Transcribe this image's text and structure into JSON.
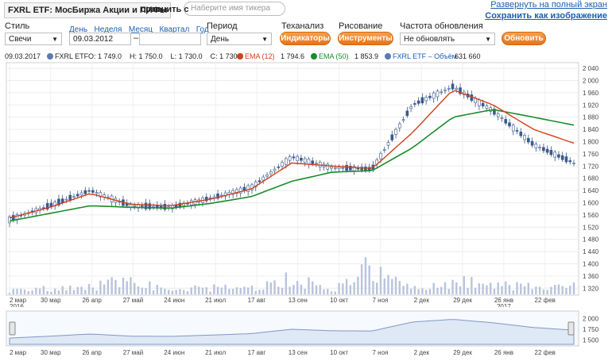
{
  "header": {
    "instrument": "FXRL ETF: МосБиржа Акции и ПИФы",
    "compare_label": "сравнить с",
    "ticker_placeholder": "Наберите имя тикера",
    "fullscreen_link": "Развернуть на полный экран",
    "save_image_link": "Сохранить как изображение"
  },
  "controls": {
    "style_label": "Стиль",
    "style_value": "Свечи",
    "period_links": [
      "День",
      "Неделя",
      "Месяц",
      "Квартал",
      "Год"
    ],
    "date_from": "09.03.2012",
    "date_dash": "–",
    "date_to": "",
    "period_label": "Период",
    "period_value": "День",
    "techanalysis_label": "Теханализ",
    "indicators_button": "Индикаторы",
    "drawing_label": "Рисование",
    "tools_button": "Инструменты",
    "refresh_label": "Частота обновления",
    "refresh_value": "Не обновлять",
    "update_button": "Обновить"
  },
  "legend": {
    "date": "09.03.2017",
    "series_name": "FXRL ETF",
    "ohlc": "O: 1 749.0    H: 1 750.0    L: 1 730.0    C: 1 730.0",
    "ema12_label": "EMA (12)",
    "ema12_value": "1 794.6",
    "ema50_label": "EMA (50)",
    "ema50_value": "1 853.9",
    "volume_label": "FXRL ETF – Объём",
    "volume_value": "631 660"
  },
  "colors": {
    "candle": "#3a5a8c",
    "ema12": "#d2401a",
    "ema50": "#1a8c2a",
    "volume": "#b8c4dc",
    "button": "#e5741b",
    "link": "#1a5fb4"
  },
  "chart_data": {
    "type": "line",
    "x": [
      "2016-03-02",
      "2016-03-30",
      "2016-04-26",
      "2016-05-27",
      "2016-06-24",
      "2016-07-21",
      "2016-08-17",
      "2016-09-13",
      "2016-10-10",
      "2016-11-07",
      "2016-12-02",
      "2016-12-29",
      "2017-01-26",
      "2017-02-22",
      "2017-03-09"
    ],
    "xtick_labels": [
      [
        "2 мар",
        "2016"
      ],
      [
        "30 мар"
      ],
      [
        "26 апр"
      ],
      [
        "27 май"
      ],
      [
        "24 июн"
      ],
      [
        "21 июл"
      ],
      [
        "17 авг"
      ],
      [
        "13 сен"
      ],
      [
        "10 окт"
      ],
      [
        "7 ноя"
      ],
      [
        "2 дек"
      ],
      [
        "29 дек"
      ],
      [
        "26 янв",
        "2017"
      ],
      [
        "22 фев"
      ]
    ],
    "yticks": [
      1320,
      1360,
      1400,
      1440,
      1480,
      1520,
      1560,
      1600,
      1640,
      1680,
      1720,
      1760,
      1800,
      1840,
      1880,
      1920,
      1960,
      2000,
      2040
    ],
    "ylim": [
      1300,
      2048
    ],
    "series": [
      {
        "name": "FXRL ETF",
        "values": [
          1545,
          1590,
          1640,
          1590,
          1585,
          1615,
          1650,
          1750,
          1715,
          1710,
          1920,
          1980,
          1900,
          1790,
          1730
        ]
      },
      {
        "name": "EMA (12)",
        "values": [
          1550,
          1585,
          1630,
          1595,
          1590,
          1612,
          1645,
          1730,
          1720,
          1712,
          1830,
          1970,
          1920,
          1840,
          1795
        ]
      },
      {
        "name": "EMA (50)",
        "values": [
          1540,
          1565,
          1590,
          1585,
          1582,
          1598,
          1620,
          1670,
          1700,
          1705,
          1780,
          1880,
          1905,
          1880,
          1854
        ]
      }
    ],
    "volume": [
      3,
      4,
      6,
      10,
      3,
      5,
      4,
      12,
      3,
      22,
      4,
      10,
      8,
      5,
      6
    ],
    "navigator": {
      "yticks": [
        1500,
        1750,
        2000
      ],
      "xtick_labels": [
        "2 мар",
        "30 мар",
        "26 апр",
        "27 май",
        "24 июн",
        "21 июл",
        "17 авг",
        "13 сен",
        "10 окт",
        "7 ноя",
        "2 дек",
        "29 дек",
        "26 янв",
        "22 фев"
      ]
    }
  }
}
